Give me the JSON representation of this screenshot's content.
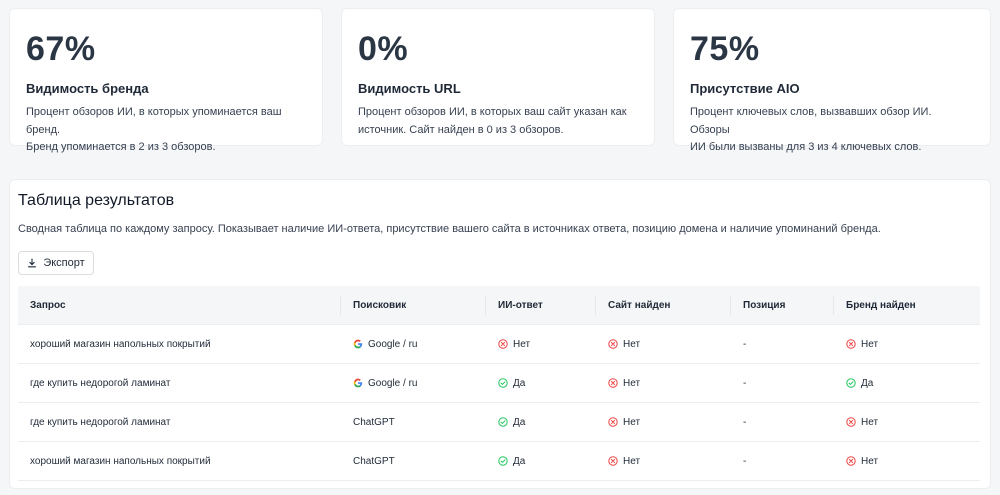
{
  "metrics": [
    {
      "value": "67%",
      "title": "Видимость бренда",
      "desc_line1": "Процент обзоров ИИ, в которых упоминается ваш бренд.",
      "desc_line2": "Бренд упоминается в 2 из 3 обзоров."
    },
    {
      "value": "0%",
      "title": "Видимость URL",
      "desc_line1": "Процент обзоров ИИ, в которых ваш сайт указан как",
      "desc_line2": "источник. Сайт найден в 0 из 3 обзоров."
    },
    {
      "value": "75%",
      "title": "Присутствие AIO",
      "desc_line1": "Процент ключевых слов, вызвавших обзор ИИ. Обзоры",
      "desc_line2": "ИИ были вызваны для 3 из 4 ключевых слов."
    }
  ],
  "results": {
    "heading": "Таблица результатов",
    "subtitle": "Сводная таблица по каждому запросу. Показывает наличие ИИ-ответа, присутствие вашего сайта в источниках ответа, позицию домена и наличие упоминаний бренда.",
    "export_label": "Экспорт",
    "columns": [
      "Запрос",
      "Поисковик",
      "ИИ-ответ",
      "Сайт найден",
      "Позиция",
      "Бренд найден"
    ],
    "rows": [
      {
        "query": "хороший магазин напольных покрытий",
        "engine": "Google / ru",
        "ai": "Нет",
        "site": "Нет",
        "position": "-",
        "brand": "Нет"
      },
      {
        "query": "где купить недорогой ламинат",
        "engine": "Google / ru",
        "ai": "Да",
        "site": "Нет",
        "position": "-",
        "brand": "Да"
      },
      {
        "query": "где купить недорогой ламинат",
        "engine": "ChatGPT",
        "ai": "Да",
        "site": "Нет",
        "position": "-",
        "brand": "Нет"
      },
      {
        "query": "хороший магазин напольных покрытий",
        "engine": "ChatGPT",
        "ai": "Да",
        "site": "Нет",
        "position": "-",
        "brand": "Нет"
      }
    ]
  },
  "colors": {
    "yes": "#22c55e",
    "no": "#ef4444"
  },
  "icons": {
    "yes": "check-circle-icon",
    "no": "x-circle-icon",
    "google": "google-logo-icon",
    "export": "download-icon"
  }
}
